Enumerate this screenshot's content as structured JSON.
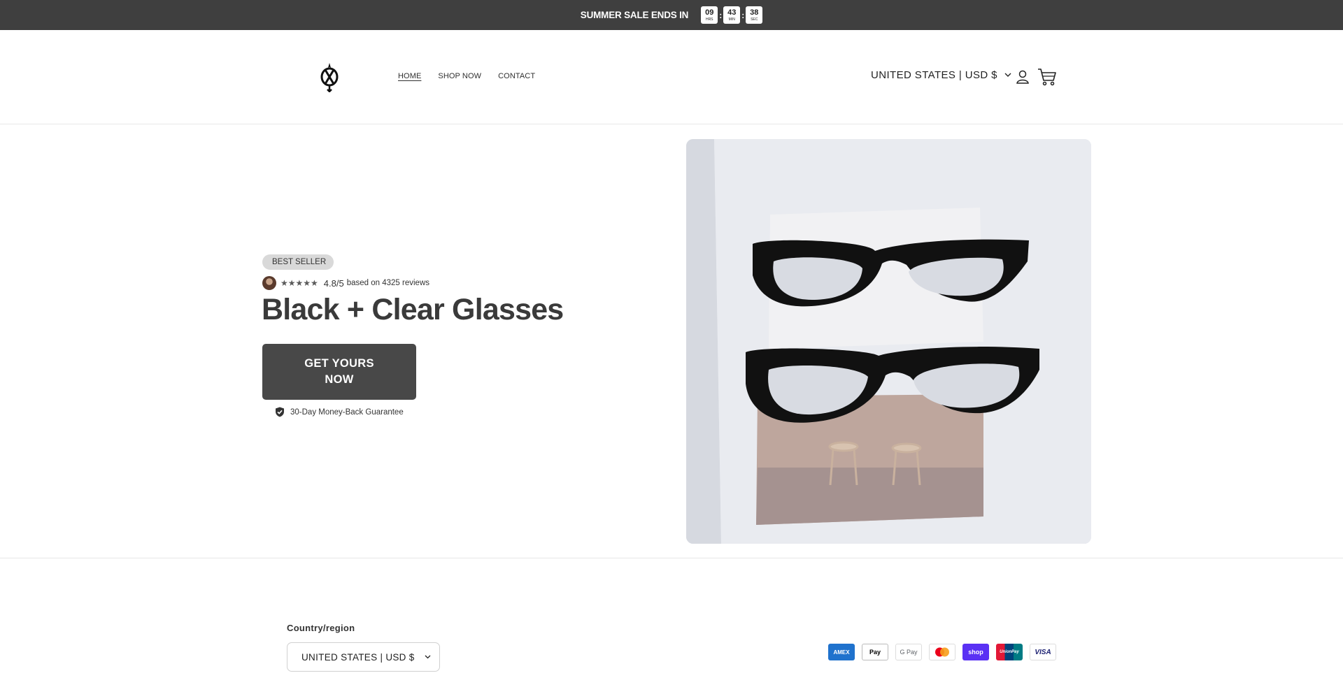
{
  "announcement": {
    "text": "SUMMER SALE ENDS IN",
    "timer": [
      {
        "value": "09",
        "unit": "HRS"
      },
      {
        "value": "43",
        "unit": "MIN"
      },
      {
        "value": "38",
        "unit": "SEC"
      }
    ]
  },
  "header": {
    "nav": [
      {
        "label": "HOME",
        "active": true
      },
      {
        "label": "SHOP NOW",
        "active": false
      },
      {
        "label": "CONTACT",
        "active": false
      }
    ],
    "locale_label": "UNITED STATES | USD $"
  },
  "hero": {
    "badge": "BEST SELLER",
    "stars": "★★★★★",
    "rating_score": "4.8/5",
    "rating_text": "based on  4325 reviews",
    "title": "Black + Clear Glasses",
    "cta_line1": "GET YOURS",
    "cta_line2": "NOW",
    "guarantee": "30-Day Money-Back Guarantee"
  },
  "footer": {
    "country_label": "Country/region",
    "country_value": "UNITED STATES | USD $",
    "payments": [
      {
        "name": "American Express",
        "text": "AMEX",
        "bg": "#1f72cd",
        "fg": "#ffffff"
      },
      {
        "name": "Apple Pay",
        "text": " Pay",
        "bg": "#ffffff",
        "fg": "#000000"
      },
      {
        "name": "Google Pay",
        "text": "G Pay",
        "bg": "#ffffff",
        "fg": "#5f6368"
      },
      {
        "name": "Mastercard",
        "text": "",
        "bg": "#ffffff",
        "fg": "#000000"
      },
      {
        "name": "Shop Pay",
        "text": "shop",
        "bg": "#5a31f4",
        "fg": "#ffffff"
      },
      {
        "name": "UnionPay",
        "text": "UnionPay",
        "bg": "#e21836",
        "fg": "#ffffff"
      },
      {
        "name": "Visa",
        "text": "VISA",
        "bg": "#ffffff",
        "fg": "#1a1f71"
      }
    ]
  }
}
